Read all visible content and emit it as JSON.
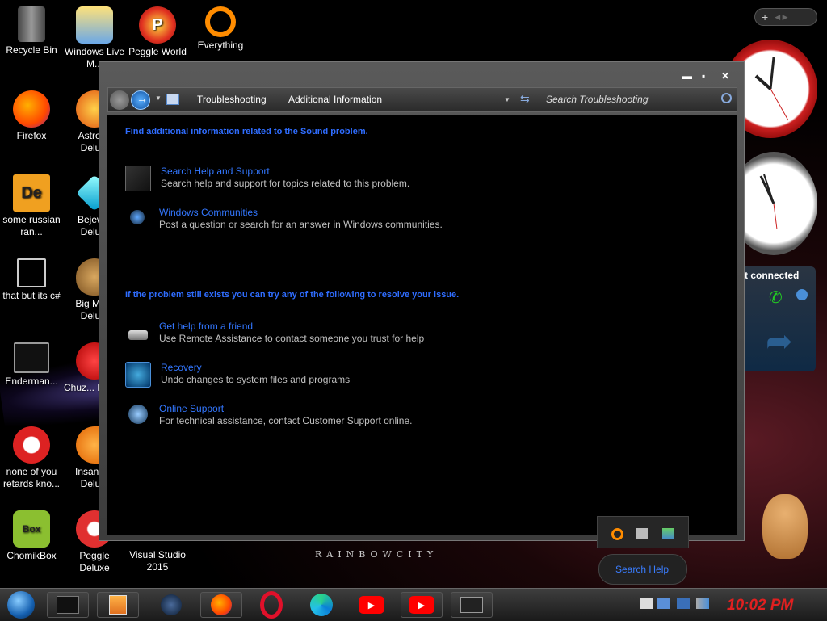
{
  "desktop": {
    "icons": [
      {
        "label": "Recycle Bin"
      },
      {
        "label": "Windows Live M..."
      },
      {
        "label": "Peggle World"
      },
      {
        "label": "Everything"
      },
      {
        "label": "Firefox"
      },
      {
        "label": "Astrol... Delu..."
      },
      {
        "label": "some russian ran..."
      },
      {
        "label": "Bejew... Delu..."
      },
      {
        "label": "that but its c#"
      },
      {
        "label": "Big Mo... Delu..."
      },
      {
        "label": "Enderman..."
      },
      {
        "label": "Chuz... Delu..."
      },
      {
        "label": "none of you retards kno..."
      },
      {
        "label": "Insanic... Delu..."
      },
      {
        "label": "ChomikBox"
      },
      {
        "label": "Peggle Deluxe"
      },
      {
        "label": "Visual Studio 2015"
      }
    ],
    "watermark": "RAINBOWCITY",
    "gadget_connection": "t connected"
  },
  "window": {
    "breadcrumb": [
      "Troubleshooting",
      "Additional Information"
    ],
    "search_placeholder": "Search Troubleshooting",
    "heading1": "Find additional information related to the Sound problem.",
    "heading2": "If the problem still exists you can try any of the following to resolve your issue.",
    "items": [
      {
        "title": "Search Help and Support",
        "desc": "Search help and support for topics related to this problem.",
        "icon": "help-support-icon"
      },
      {
        "title": "Windows Communities",
        "desc": "Post a question or search for an answer in Windows communities.",
        "icon": "communities-icon"
      },
      {
        "title": "Get help from a friend",
        "desc": "Use Remote Assistance to contact someone you trust for help",
        "icon": "remote-assistance-icon"
      },
      {
        "title": "Recovery",
        "desc": "Undo changes to system files and programs",
        "icon": "recovery-icon"
      },
      {
        "title": "Online Support",
        "desc": "For technical assistance, contact Customer Support online.",
        "icon": "online-support-icon"
      }
    ]
  },
  "tray_popup": {
    "search_label": "Search Help"
  },
  "taskbar": {
    "time": "10:02 PM",
    "apps": [
      "start",
      "black-box",
      "media-player",
      "globe",
      "firefox",
      "opera",
      "edge",
      "youtube",
      "youtube",
      "window-switcher"
    ]
  },
  "colors": {
    "link": "#3377ff",
    "time": "#e02020"
  }
}
